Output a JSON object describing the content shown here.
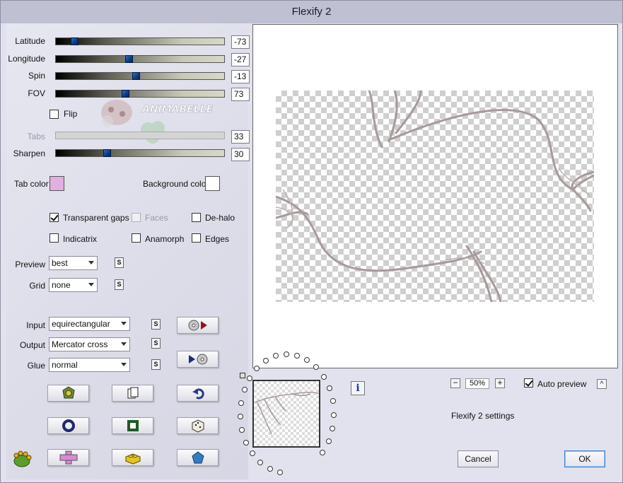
{
  "window": {
    "title": "Flexify 2"
  },
  "sliders": [
    {
      "label": "Latitude",
      "value": "-73",
      "fraction": 0.11,
      "enabled": true
    },
    {
      "label": "Longitude",
      "value": "-27",
      "fraction": 0.43,
      "enabled": true
    },
    {
      "label": "Spin",
      "value": "-13",
      "fraction": 0.47,
      "enabled": true
    },
    {
      "label": "FOV",
      "value": "73",
      "fraction": 0.41,
      "enabled": true
    },
    {
      "label": "Tabs",
      "value": "33",
      "fraction": null,
      "enabled": false
    },
    {
      "label": "Sharpen",
      "value": "30",
      "fraction": 0.3,
      "enabled": true
    }
  ],
  "flip": {
    "label": "Flip",
    "checked": false
  },
  "watermark": {
    "text": "ANIMABELLE"
  },
  "colors": {
    "tab_color_label": "Tab color",
    "tab_color": "#e0b0e0",
    "background_color_label": "Background color",
    "background_color": "#ffffff"
  },
  "options": {
    "transparent_gaps": {
      "label": "Transparent gaps",
      "checked": true
    },
    "faces": {
      "label": "Faces",
      "checked": false,
      "enabled": false
    },
    "de_halo": {
      "label": "De-halo",
      "checked": false
    },
    "indicatrix": {
      "label": "Indicatrix",
      "checked": false
    },
    "anamorph": {
      "label": "Anamorph",
      "checked": false
    },
    "edges": {
      "label": "Edges",
      "checked": false
    }
  },
  "preview_select": {
    "label": "Preview",
    "value": "best"
  },
  "grid_select": {
    "label": "Grid",
    "value": "none"
  },
  "input_select": {
    "label": "Input",
    "value": "equirectangular"
  },
  "output_select": {
    "label": "Output",
    "value": "Mercator cross"
  },
  "glue_select": {
    "label": "Glue",
    "value": "normal"
  },
  "s_button_label": "S",
  "zoom": {
    "value": "50%",
    "minus": "−",
    "plus": "+"
  },
  "auto_preview": {
    "label": "Auto preview",
    "checked": true
  },
  "collapse_label": "^",
  "settings_label": "Flexify 2 settings",
  "info_label": "i",
  "buttons": {
    "cancel": "Cancel",
    "ok": "OK"
  },
  "icons": {
    "tool_buttons": [
      "frog-shield-icon",
      "page-copy-icon",
      "undo-icon",
      "ring-icon",
      "square-frame-icon",
      "dice-icon",
      "pink-cross-icon",
      "lego-brick-icon",
      "pentagon-icon"
    ],
    "input_preview": "disc-play-icon",
    "output_preview": "play-disc-icon",
    "logo": "frog-paw-icon"
  }
}
